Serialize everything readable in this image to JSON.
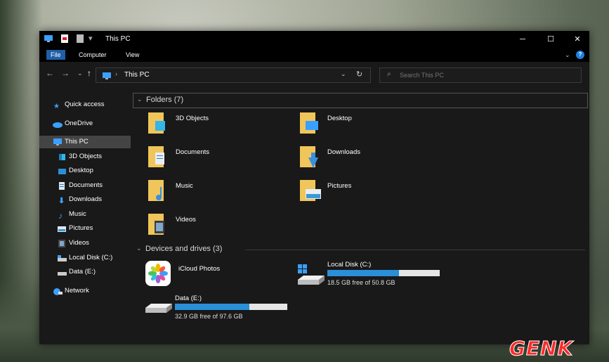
{
  "window": {
    "title": "This PC",
    "ribbon_tabs": [
      "File",
      "Computer",
      "View"
    ]
  },
  "address": {
    "location": "This PC"
  },
  "search": {
    "placeholder": "Search This PC"
  },
  "sidebar": {
    "items": [
      {
        "label": "Quick access",
        "icon": "star-icon"
      },
      {
        "label": "OneDrive",
        "icon": "cloud-icon"
      },
      {
        "label": "This PC",
        "icon": "monitor-icon",
        "selected": true
      },
      {
        "label": "3D Objects",
        "icon": "cube-icon"
      },
      {
        "label": "Desktop",
        "icon": "desktop-icon"
      },
      {
        "label": "Documents",
        "icon": "document-icon"
      },
      {
        "label": "Downloads",
        "icon": "download-icon"
      },
      {
        "label": "Music",
        "icon": "music-icon"
      },
      {
        "label": "Pictures",
        "icon": "pictures-icon"
      },
      {
        "label": "Videos",
        "icon": "videos-icon"
      },
      {
        "label": "Local Disk (C:)",
        "icon": "drive-icon"
      },
      {
        "label": "Data (E:)",
        "icon": "drive-icon"
      },
      {
        "label": "Network",
        "icon": "network-icon"
      }
    ]
  },
  "folders": {
    "header": "Folders (7)",
    "items": [
      "3D Objects",
      "Desktop",
      "Documents",
      "Downloads",
      "Music",
      "Pictures",
      "Videos"
    ]
  },
  "devices": {
    "header": "Devices and drives (3)",
    "icloud": "iCloud Photos",
    "drives": [
      {
        "name": "Local Disk (C:)",
        "free_text": "18.5 GB free of 50.8 GB",
        "used_fraction": 0.636
      },
      {
        "name": "Data (E:)",
        "free_text": "32.9 GB free of 97.6 GB",
        "used_fraction": 0.663
      }
    ]
  },
  "watermark": "GENK",
  "colors": {
    "accent": "#2b8fd8",
    "folder": "#f0c65a",
    "window_bg": "#191919",
    "selected": "#444444"
  }
}
